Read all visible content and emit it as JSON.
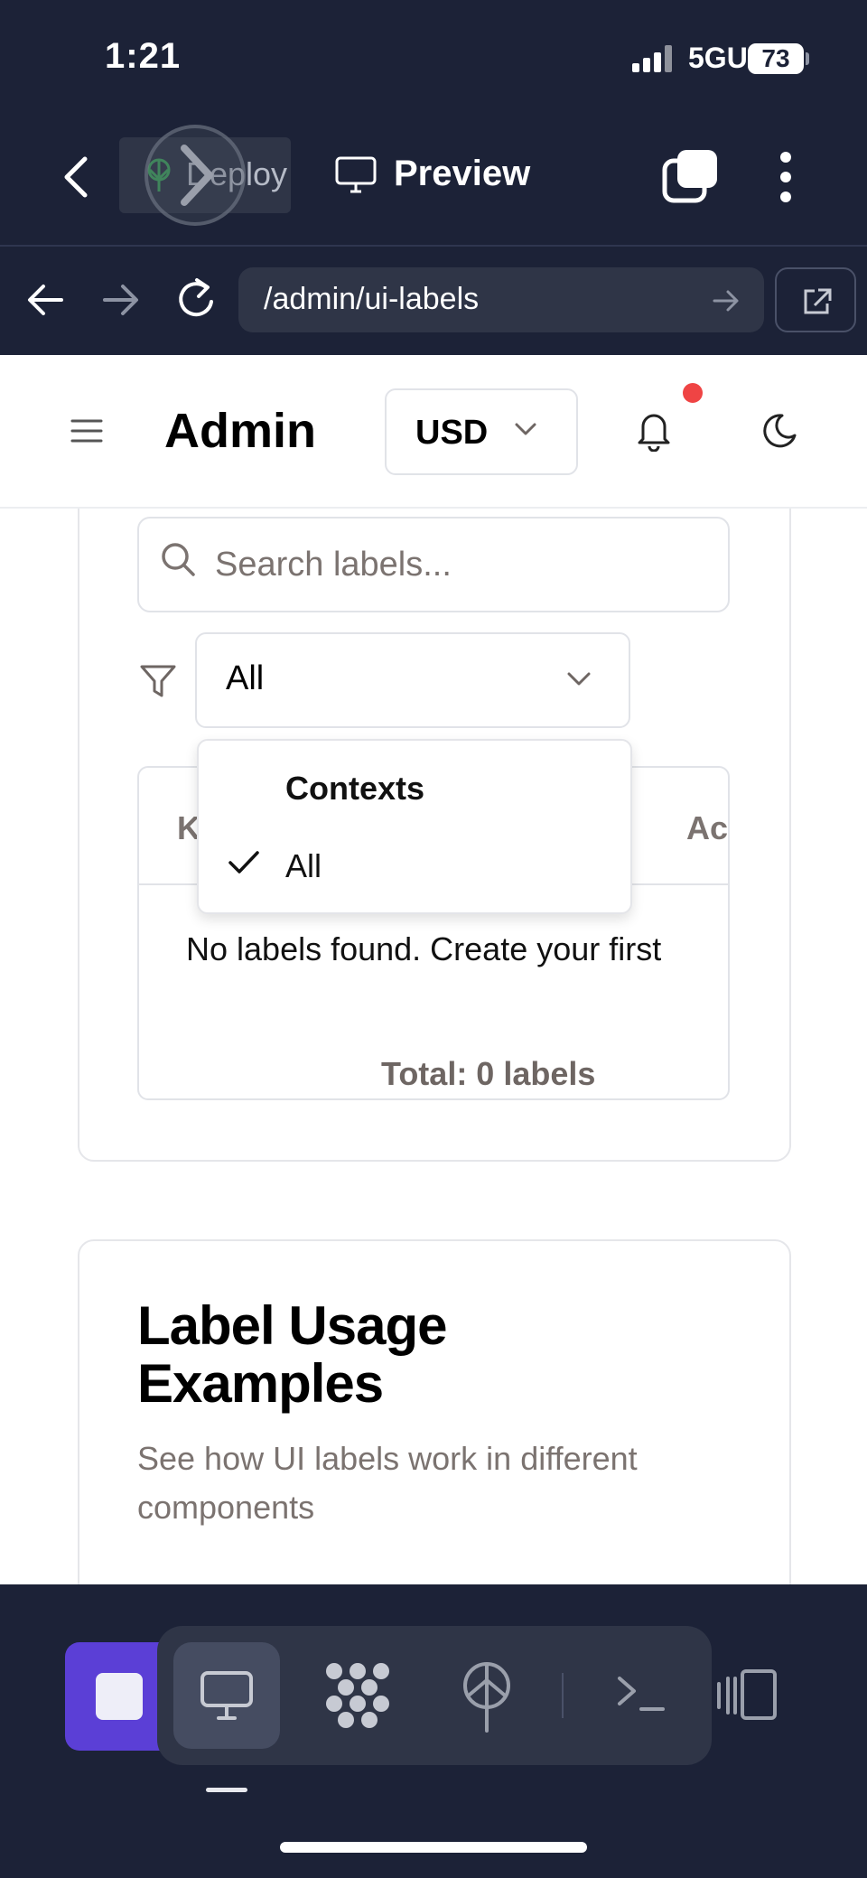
{
  "status_bar": {
    "time": "1:21",
    "network": "5GUC",
    "battery": "73"
  },
  "browser": {
    "deploy_label": "Deploy",
    "preview_label": "Preview",
    "url": "/admin/ui-labels"
  },
  "header": {
    "title": "Admin",
    "currency": "USD"
  },
  "labels_panel": {
    "search_placeholder": "Search labels...",
    "context_filter_value": "All",
    "columns": {
      "key": "K",
      "actions": "Ac"
    },
    "empty_message": "No labels found. Create your first",
    "total": "Total: 0 labels"
  },
  "context_menu": {
    "heading": "Contexts",
    "options": [
      {
        "label": "All",
        "selected": true
      }
    ]
  },
  "usage_card": {
    "title": "Label Usage Examples",
    "subtitle": "See how UI labels work in different components"
  },
  "colors": {
    "chrome_bg": "#1c2237",
    "accent": "#5b3fd6",
    "notification_dot": "#ef4444"
  },
  "icons": [
    "back-icon",
    "deploy-icon",
    "preview-icon",
    "tabs-icon",
    "more-icon",
    "arrow-left-icon",
    "arrow-right-icon",
    "reload-icon",
    "open-external-icon",
    "menu-icon",
    "chevron-down-icon",
    "bell-icon",
    "moon-icon",
    "search-icon",
    "filter-icon",
    "check-icon",
    "stop-icon",
    "monitor-icon",
    "apps-icon",
    "deploy-tool-icon",
    "terminal-icon",
    "devices-icon"
  ]
}
